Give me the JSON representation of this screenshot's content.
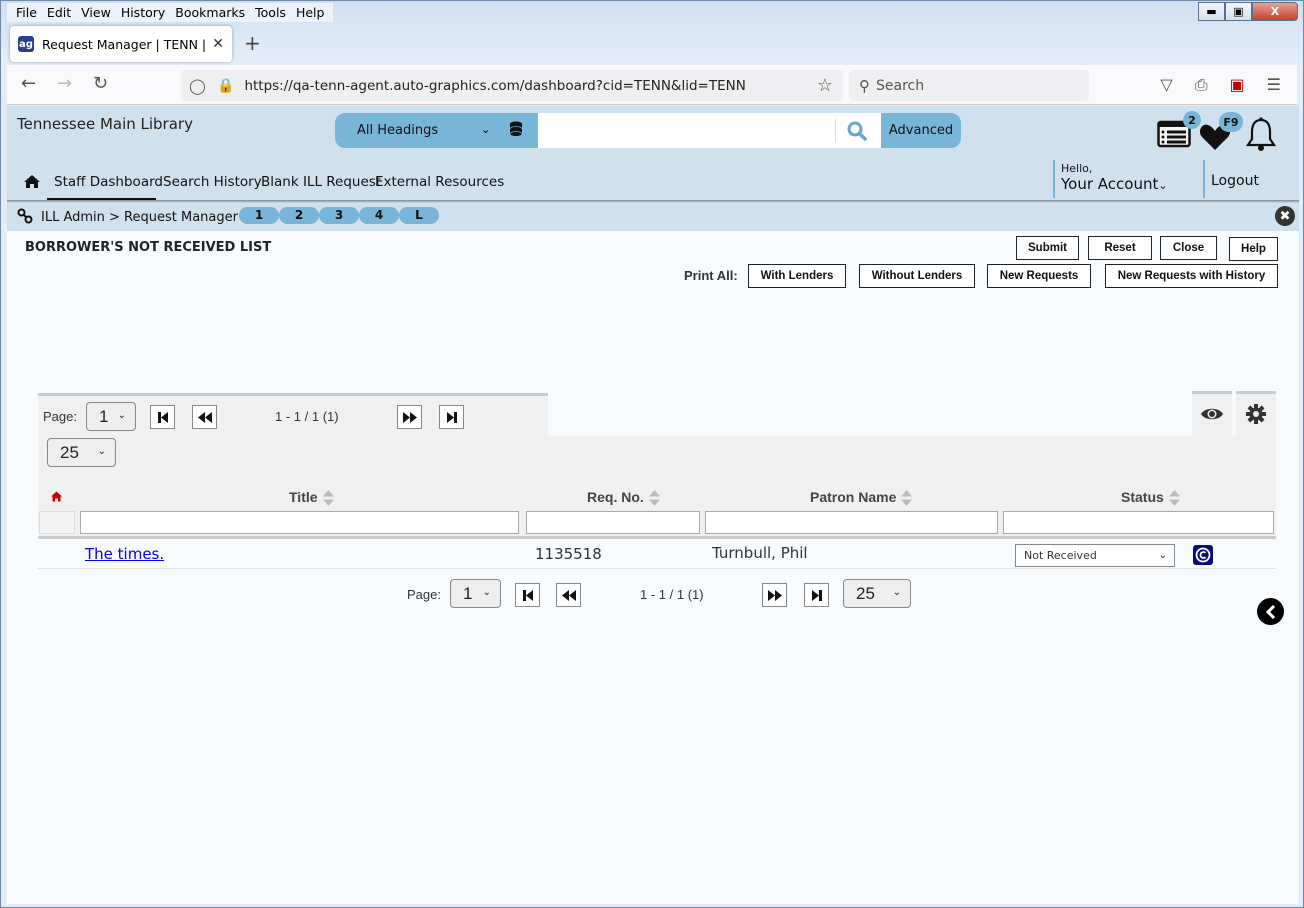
{
  "browser": {
    "menu": [
      "File",
      "Edit",
      "View",
      "History",
      "Bookmarks",
      "Tools",
      "Help"
    ],
    "tab_title": "Request Manager | TENN | tenn",
    "url": "https://qa-tenn-agent.auto-graphics.com/dashboard?cid=TENN&lid=TENN",
    "search_placeholder": "Search"
  },
  "header": {
    "library_name": "Tennessee Main Library",
    "search_scope": "All Headings",
    "search_value": "",
    "advanced_label": "Advanced",
    "list_badge": "2",
    "favorites_badge": "F9",
    "greeting": "Hello,",
    "account_label": "Your Account",
    "logout_label": "Logout"
  },
  "nav": {
    "items": [
      {
        "label": "Staff Dashboard",
        "active": true
      },
      {
        "label": "Search History",
        "active": false
      },
      {
        "label": "Blank ILL Request",
        "active": false
      },
      {
        "label": "External Resources",
        "active": false
      }
    ]
  },
  "breadcrumb": {
    "text": "ILL Admin > Request Manager",
    "pills": [
      "1",
      "2",
      "3",
      "4",
      "L"
    ]
  },
  "panel": {
    "title": "BORROWER'S NOT RECEIVED LIST",
    "actions": [
      "Submit",
      "Reset",
      "Close",
      "Help"
    ],
    "print_all_label": "Print All:",
    "print_options": [
      "With Lenders",
      "Without Lenders",
      "New Requests",
      "New Requests with History"
    ]
  },
  "pager": {
    "page_label": "Page:",
    "page_value": "1",
    "range_text": "1 - 1 / 1 (1)",
    "page_size": "25"
  },
  "table": {
    "columns": [
      "Title",
      "Req. No.",
      "Patron Name",
      "Status"
    ],
    "rows": [
      {
        "title": "The times.",
        "req_no": "1135518",
        "patron": "Turnbull, Phil",
        "status": "Not Received"
      }
    ]
  },
  "colors": {
    "accent": "#78b5d6",
    "header_bg": "#cfe1ec",
    "link": "#0000ee"
  }
}
